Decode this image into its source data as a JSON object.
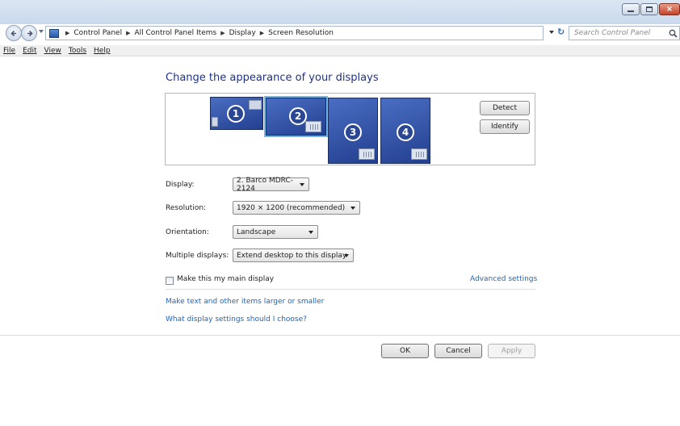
{
  "window": {
    "buttons": {
      "minimize": "minimize",
      "maximize": "maximize",
      "close": "×"
    }
  },
  "address": {
    "breadcrumbs": [
      "Control Panel",
      "All Control Panel Items",
      "Display",
      "Screen Resolution"
    ],
    "search_placeholder": "Search Control Panel"
  },
  "menu": [
    "File",
    "Edit",
    "View",
    "Tools",
    "Help"
  ],
  "main": {
    "heading": "Change the appearance of your displays",
    "monitors": [
      "1",
      "2",
      "3",
      "4"
    ],
    "detect_label": "Detect",
    "identify_label": "Identify",
    "display_label": "Display:",
    "display_value": "2. Barco MDRC-2124",
    "resolution_label": "Resolution:",
    "resolution_value": "1920 × 1200 (recommended)",
    "orientation_label": "Orientation:",
    "orientation_value": "Landscape",
    "multiple_label": "Multiple displays:",
    "multiple_value": "Extend desktop to this display",
    "main_display_label": "Make this my main display",
    "advanced_link": "Advanced settings",
    "text_size_link": "Make text and other items larger or smaller",
    "help_link": "What display settings should I choose?"
  },
  "footer": {
    "ok_label": "OK",
    "cancel_label": "Cancel",
    "apply_label": "Apply"
  },
  "colors": {
    "heading": "#1e3287",
    "link": "#1f63b8",
    "monitor": "#2f4fa2",
    "selected_outline": "#6fb6ea"
  }
}
